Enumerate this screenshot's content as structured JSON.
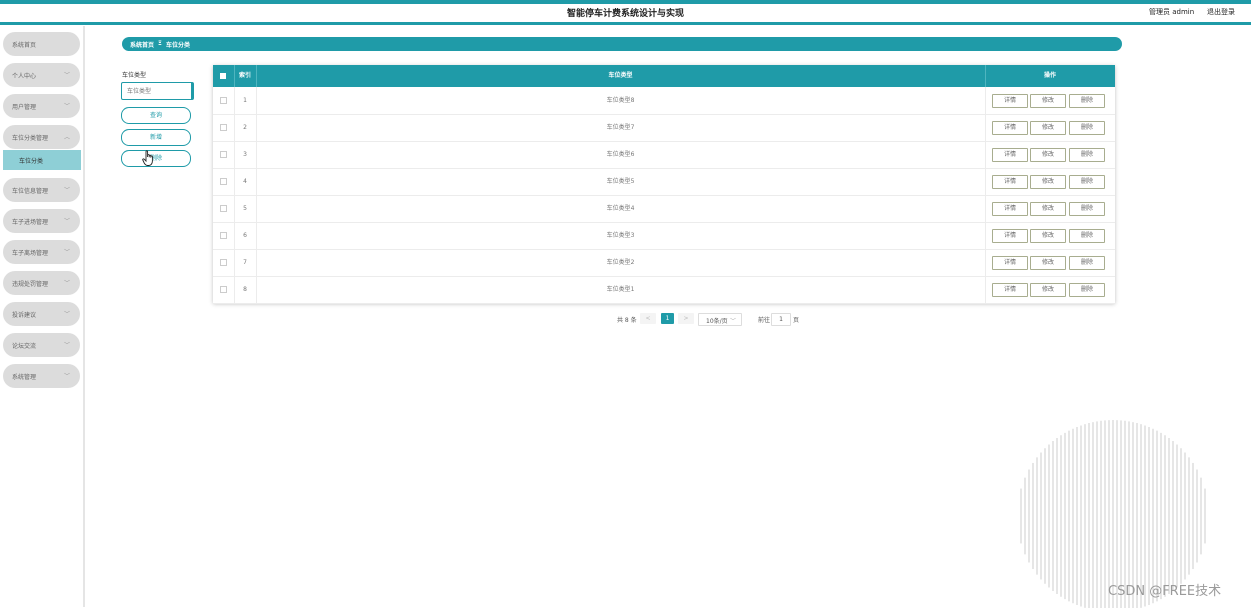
{
  "header": {
    "title": "智能停车计费系统设计与实现",
    "user_label": "管理员 admin",
    "logout_label": "退出登录"
  },
  "sidebar": {
    "items": [
      {
        "label": "系统首页",
        "has_chevron": false
      },
      {
        "label": "个人中心",
        "has_chevron": true
      },
      {
        "label": "用户管理",
        "has_chevron": true
      },
      {
        "label": "车位分类管理",
        "has_chevron": true,
        "expanded": true
      },
      {
        "label": "车位信息管理",
        "has_chevron": true
      },
      {
        "label": "车子进场管理",
        "has_chevron": true
      },
      {
        "label": "车子离场管理",
        "has_chevron": true
      },
      {
        "label": "违规处罚管理",
        "has_chevron": true
      },
      {
        "label": "投诉建议",
        "has_chevron": true
      },
      {
        "label": "论坛交流",
        "has_chevron": true
      },
      {
        "label": "系统管理",
        "has_chevron": true
      }
    ],
    "sub_active": "车位分类"
  },
  "breadcrumb": {
    "home": "系统首页",
    "separator": "Ξ",
    "current": "车位分类"
  },
  "search": {
    "label": "车位类型",
    "placeholder": "车位类型",
    "query_button": "查询",
    "add_button": "新增",
    "delete_button": "删除"
  },
  "table": {
    "headers": {
      "index": "索引",
      "type": "车位类型",
      "ops": "操作"
    },
    "rows": [
      {
        "index": "1",
        "type": "车位类型8"
      },
      {
        "index": "2",
        "type": "车位类型7"
      },
      {
        "index": "3",
        "type": "车位类型6"
      },
      {
        "index": "4",
        "type": "车位类型5"
      },
      {
        "index": "5",
        "type": "车位类型4"
      },
      {
        "index": "6",
        "type": "车位类型3"
      },
      {
        "index": "7",
        "type": "车位类型2"
      },
      {
        "index": "8",
        "type": "车位类型1"
      }
    ],
    "op_labels": {
      "detail": "详情",
      "edit": "修改",
      "delete": "删除"
    }
  },
  "pagination": {
    "total": "共 8 条",
    "prev": "<",
    "current_page": "1",
    "next": ">",
    "page_size": "10条/页",
    "goto_prefix": "前往",
    "goto_value": "1",
    "goto_suffix": "页"
  },
  "watermark": "CSDN @FREE技术",
  "colors": {
    "accent": "#1f9ba8",
    "sidebar_item": "#dcdcdc",
    "sidebar_active": "#8ecfd6"
  }
}
